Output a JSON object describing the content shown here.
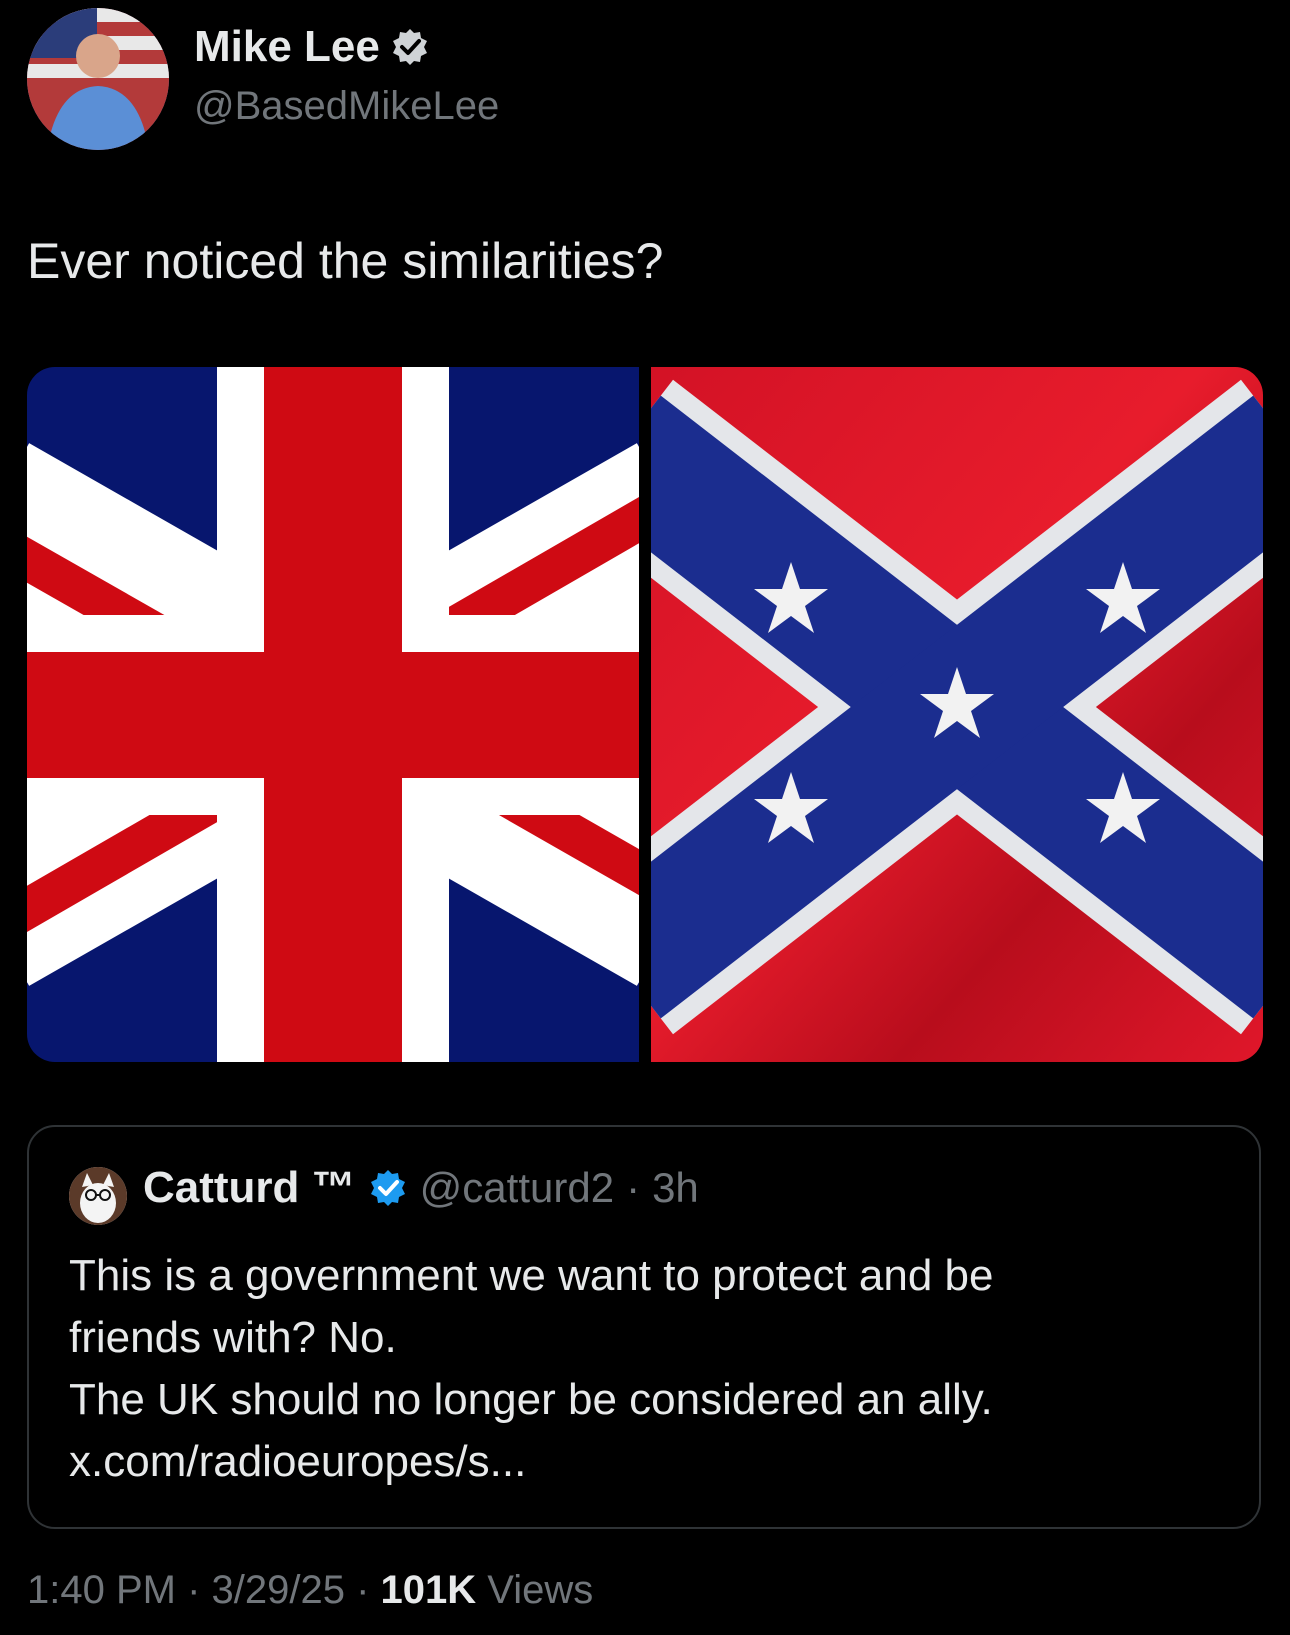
{
  "author": {
    "name": "Mike Lee",
    "handle": "@BasedMikeLee"
  },
  "tweet": {
    "text": "Ever noticed the similarities?"
  },
  "media": {
    "left_image": "union-jack-flag",
    "right_image": "confederate-battle-flag"
  },
  "quote": {
    "name": "Catturd ™",
    "handle": "@catturd2",
    "separator": "·",
    "age": "3h",
    "lines": [
      "This is a government we want to protect and be",
      "friends with? No.",
      "The UK should no longer be considered an ally.",
      "x.com/radioeuropes/s..."
    ]
  },
  "footer": {
    "time": "1:40 PM",
    "sep1": " · ",
    "date": "3/29/25",
    "sep2": " · ",
    "views_count": "101K",
    "views_label": " Views"
  },
  "colors": {
    "background": "#000000",
    "text_primary": "#e7e9ea",
    "text_secondary": "#71767b",
    "verified_blue": "#1d9bf0",
    "border": "#2f3336"
  }
}
